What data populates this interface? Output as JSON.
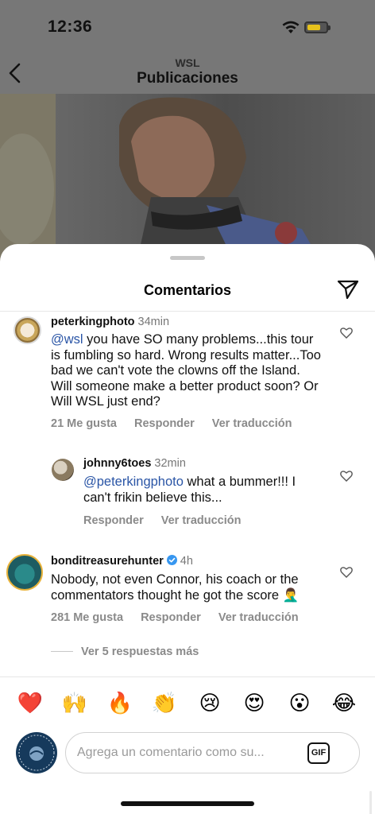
{
  "status_bar": {
    "time": "12:36",
    "battery_color": "#e6c21c"
  },
  "header": {
    "account": "WSL",
    "title": "Publicaciones"
  },
  "sheet": {
    "title": "Comentarios"
  },
  "comments": [
    {
      "username": "peterkingphoto",
      "time": "34min",
      "mention": "@wsl",
      "text": " you have SO many problems...this tour is fumbling so hard. Wrong results matter...Too bad we can't vote the clowns off the Island. Will someone make a better product soon? Or Will WSL just end?",
      "likes": "21 Me gusta",
      "reply": "Responder",
      "translate": "Ver traducción"
    },
    {
      "username": "johnny6toes",
      "time": "32min",
      "mention": "@peterkingphoto",
      "text": " what a bummer!!! I can't frikin believe this...",
      "reply": "Responder",
      "translate": "Ver traducción"
    },
    {
      "username": "bonditreasurehunter",
      "time": "4h",
      "verified": true,
      "text": "Nobody, not even Connor, his coach or the commentators thought he got the score 🤦‍♂️",
      "likes": "281 Me gusta",
      "reply": "Responder",
      "translate": "Ver traducción"
    }
  ],
  "more_replies": "Ver 5 respuestas más",
  "reactions": [
    "❤️",
    "🙌",
    "🔥",
    "👏",
    "😢",
    "😍",
    "😮",
    "😂"
  ],
  "composer": {
    "placeholder": "Agrega un comentario como su...",
    "gif_label": "GIF"
  },
  "colors": {
    "mention": "#2a55a6",
    "verified": "#3797f0",
    "secondary_text": "#8a8a8a"
  }
}
